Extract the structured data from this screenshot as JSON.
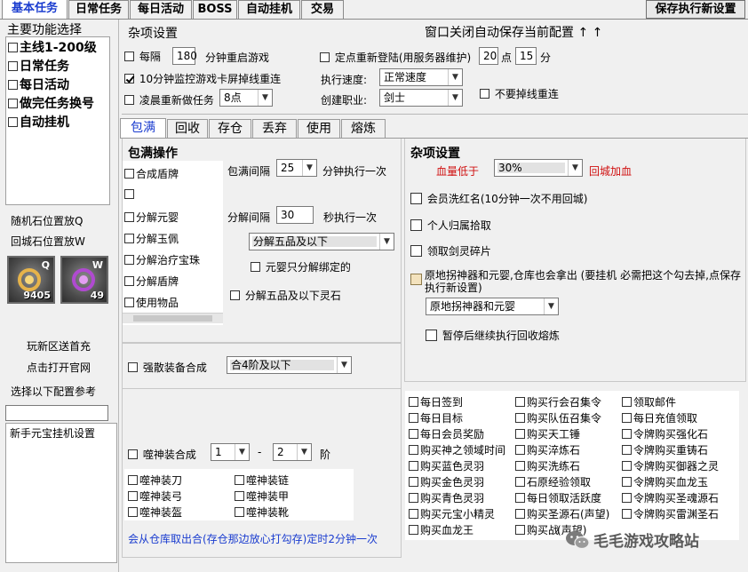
{
  "main_tabs": [
    {
      "label": "基本任务"
    },
    {
      "label": "日常任务"
    },
    {
      "label": "每日活动"
    },
    {
      "label": "BOSS"
    },
    {
      "label": "自动挂机"
    },
    {
      "label": "交易"
    }
  ],
  "save_button": "保存执行新设置",
  "sidebar": {
    "title": "主要功能选择",
    "items": [
      {
        "label": "主线1-200级"
      },
      {
        "label": "日常任务"
      },
      {
        "label": "每日活动"
      },
      {
        "label": "做完任务换号"
      },
      {
        "label": "自动挂机"
      }
    ],
    "random_stone_label": "随机石位置放Q",
    "return_stone_label": "回城石位置放W",
    "slot_q": {
      "key": "Q",
      "qty": "9405"
    },
    "slot_w": {
      "key": "W",
      "qty": "49"
    },
    "link_new_server": "玩新区送首充",
    "link_official": "点击打开官网",
    "link_config_ref": "选择以下配置参考",
    "config_input": "",
    "config_list": [
      "新手元宝挂机设置"
    ]
  },
  "misc_top": {
    "title": "杂项设置",
    "window_close_note": "窗口关闭自动保存当前配置 ↑ ↑",
    "every_label": "每隔",
    "every_value": "180",
    "every_suffix": "分钟重启游戏",
    "monitor_label": "10分钟监控游戏卡屏掉线重连",
    "dawn_label": "凌晨重新做任务",
    "dawn_value": "8点",
    "relogin_label": "定点重新登陆(用服务器维护)",
    "relogin_hour": "20",
    "hour_unit": "点",
    "relogin_min": "15",
    "min_unit": "分",
    "speed_label": "执行速度:",
    "speed_value": "正常速度",
    "class_label": "创建职业:",
    "class_value": "剑士",
    "no_drop_label": "不要掉线重连"
  },
  "sub_tabs": [
    {
      "label": "包满"
    },
    {
      "label": "回收"
    },
    {
      "label": "存仓"
    },
    {
      "label": "丢弃"
    },
    {
      "label": "使用"
    },
    {
      "label": "熔炼"
    }
  ],
  "bag_ops": {
    "title": "包满操作",
    "list": [
      {
        "label": "合成盾牌"
      },
      {
        "label": ""
      },
      {
        "label": "分解元婴"
      },
      {
        "label": "分解玉佩"
      },
      {
        "label": "分解治疗宝珠"
      },
      {
        "label": "分解盾牌"
      },
      {
        "label": "使用物品"
      }
    ],
    "interval_label": "包满间隔",
    "interval_value": "25",
    "interval_suffix": "分钟执行一次",
    "decompose_label": "分解间隔",
    "decompose_value": "30",
    "decompose_suffix": "秒执行一次",
    "decompose_select": "分解五品及以下",
    "yuanying_bound": "元婴只分解绑定的",
    "spirit_stone": "分解五品及以下灵石"
  },
  "strengthen": {
    "label": "强散装备合成",
    "value": "合4阶及以下"
  },
  "devour": {
    "label": "噬神装合成",
    "from": "1",
    "dash": "-",
    "to": "2",
    "unit": "阶",
    "items": [
      {
        "label": "噬神装刀"
      },
      {
        "label": "噬神装链"
      },
      {
        "label": "噬神装弓"
      },
      {
        "label": "噬神装甲"
      },
      {
        "label": "噬神装盔"
      },
      {
        "label": "噬神装靴"
      }
    ],
    "note": "会从仓库取出合(存仓那边放心打勾存)定时2分钟一次"
  },
  "misc_right": {
    "title": "杂项设置",
    "hp_low_label": "血量低于",
    "hp_value": "30%",
    "hp_action": "回城加血",
    "red_name": "会员洗红名(10分钟一次不用回城)",
    "personal_pickup": "个人归属拾取",
    "sword_shards": "领取剑灵碎片",
    "guard_note": "原地拐神器和元婴,仓库也会拿出 (要挂机 必需把这个勾去掉,点保存执行新设置)",
    "guard_select": "原地拐神器和元婴",
    "pause_note": "暂停后继续执行回收熔炼"
  },
  "daily_grid": {
    "col1": [
      "每日签到",
      "每日目标",
      "每日会员奖励",
      "购买神之领域时间",
      "购买蓝色灵羽",
      "购买金色灵羽",
      "购买青色灵羽",
      "购买元宝小精灵",
      "购买血龙王"
    ],
    "col2": [
      "购买行会召集令",
      "购买队伍召集令",
      "购买天工锤",
      "购买淬炼石",
      "购买洗练石",
      "石原经验领取",
      "每日领取活跃度",
      "购买圣源石(声望)",
      "购买战"
    ],
    "col3": [
      "领取邮件",
      "每日充值领取",
      "令牌购买强化石",
      "令牌购买重铸石",
      "令牌购买御器之灵",
      "令牌购买血龙玉",
      "令牌购买圣魂源石",
      "令牌购买雷渊圣石",
      ""
    ],
    "col2_overlap": "(声望)"
  },
  "watermark": {
    "text": "毛毛游戏攻略站"
  },
  "colors": {
    "accent": "#1a3ccf",
    "alert": "#d01010",
    "panel": "#f0f0f0"
  }
}
